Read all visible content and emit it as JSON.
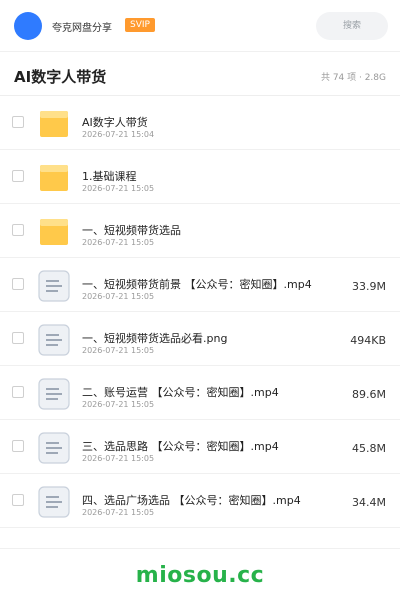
{
  "header": {
    "share_name": "夸克网盘分享",
    "badge": "SVIP",
    "search_placeholder": "搜索"
  },
  "folder": {
    "title": "AI数字人带货",
    "meta": "共 74 项 · 2.8G"
  },
  "files": [
    {
      "type": "folder",
      "name": "AI数字人带货",
      "date": "2026-07-21 15:04",
      "size": ""
    },
    {
      "type": "folder",
      "name": "1.基础课程",
      "date": "2026-07-21 15:05",
      "size": ""
    },
    {
      "type": "folder",
      "name": "一、短视频带货选品",
      "date": "2026-07-21 15:05",
      "size": ""
    },
    {
      "type": "file",
      "name": "一、短视频带货前景 【公众号：密知圈】.mp4",
      "date": "2026-07-21 15:05",
      "size": "33.9M"
    },
    {
      "type": "file",
      "name": "一、短视频带货选品必看.png",
      "date": "2026-07-21 15:05",
      "size": "494KB"
    },
    {
      "type": "file",
      "name": "二、账号运营 【公众号：密知圈】.mp4",
      "date": "2026-07-21 15:05",
      "size": "89.6M"
    },
    {
      "type": "file",
      "name": "三、选品思路 【公众号：密知圈】.mp4",
      "date": "2026-07-21 15:05",
      "size": "45.8M"
    },
    {
      "type": "file",
      "name": "四、选品广场选品 【公众号：密知圈】.mp4",
      "date": "2026-07-21 15:05",
      "size": "34.4M"
    }
  ],
  "footer": {
    "brand": "miosou.cc"
  },
  "colors": {
    "avatar": "#2f7bff",
    "svip": "#ff9a2e",
    "brand": "#27b24a",
    "folder": "#ffc94a"
  }
}
